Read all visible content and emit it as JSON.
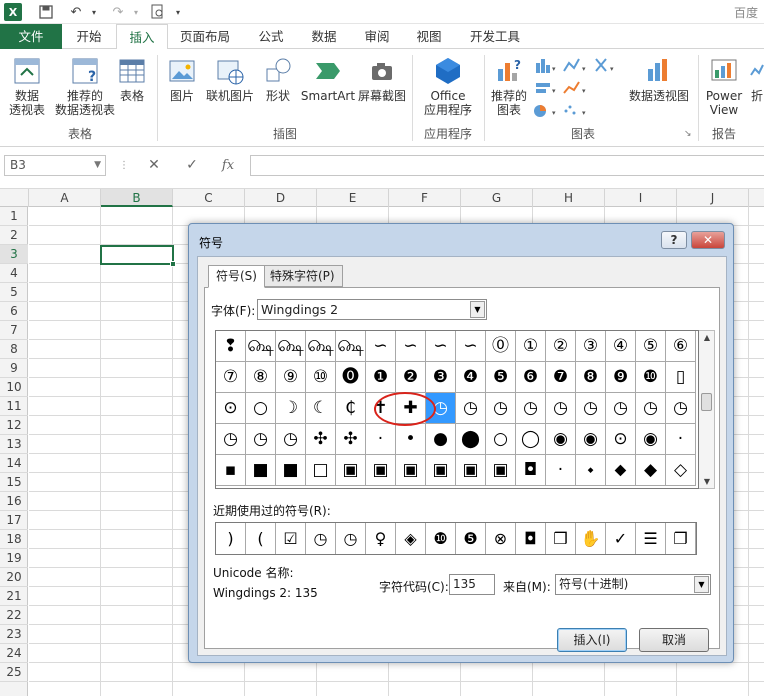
{
  "titlebar": {
    "right_text": "百度",
    "undo_icon": "undo-icon",
    "redo_icon": "redo-icon"
  },
  "ribbon": {
    "tabs": [
      "文件",
      "开始",
      "插入",
      "页面布局",
      "公式",
      "数据",
      "审阅",
      "视图",
      "开发工具"
    ],
    "active_tab": "插入",
    "buttons": [
      {
        "label": "数据\n透视表"
      },
      {
        "label": "推荐的\n数据透视表"
      },
      {
        "label": "表格"
      },
      {
        "label": "图片"
      },
      {
        "label": "联机图片"
      },
      {
        "label": "形状"
      },
      {
        "label": "SmartArt"
      },
      {
        "label": "屏幕截图"
      },
      {
        "label": "Office\n应用程序"
      },
      {
        "label": "推荐的\n图表"
      },
      {
        "label": "数据透视图"
      },
      {
        "label": "Power\nView"
      },
      {
        "label": "折"
      }
    ],
    "groups": [
      "表格",
      "插图",
      "应用程序",
      "图表",
      "报告"
    ]
  },
  "formula_bar": {
    "name_box": "B3",
    "cancel": "✕",
    "enter": "✓",
    "fx": "fx",
    "value": ""
  },
  "grid": {
    "columns": [
      "A",
      "B",
      "C",
      "D",
      "E",
      "F",
      "G",
      "H",
      "I",
      "J"
    ],
    "rows": [
      "1",
      "2",
      "3",
      "4",
      "5",
      "6",
      "7",
      "8",
      "9",
      "10",
      "11",
      "12",
      "13",
      "14",
      "15",
      "16",
      "17",
      "18",
      "19",
      "20",
      "21",
      "22",
      "23",
      "24",
      "25"
    ],
    "selected_cell": "B3"
  },
  "dialog": {
    "title": "符号",
    "help": "?",
    "close": "✕",
    "tab_symbols": "符号(S)",
    "tab_special": "特殊字符(P)",
    "font_label": "字体(F):",
    "font_value": "Wingdings 2",
    "symbols": [
      [
        "❢",
        "௸",
        "௸",
        "௸",
        "௸",
        "∽",
        "∽",
        "∽",
        "∽",
        "⓪",
        "①",
        "②",
        "③",
        "④",
        "⑤",
        "⑥"
      ],
      [
        "⑦",
        "⑧",
        "⑨",
        "⑩",
        "⓿",
        "❶",
        "❷",
        "❸",
        "❹",
        "❺",
        "❻",
        "❼",
        "❽",
        "❾",
        "❿",
        "▯"
      ],
      [
        "⊙",
        "○",
        "☽",
        "☾",
        "₵",
        "✝",
        "✚",
        "◷",
        "◷",
        "◷",
        "◷",
        "◷",
        "◷",
        "◷",
        "◷",
        "◷"
      ],
      [
        "◷",
        "◷",
        "◷",
        "✣",
        "✣",
        "·",
        "•",
        "●",
        "⬤",
        "○",
        "◯",
        "◉",
        "◉",
        "⊙",
        "◉",
        "·"
      ],
      [
        "▪",
        "■",
        "■",
        "□",
        "▣",
        "▣",
        "▣",
        "▣",
        "▣",
        "▣",
        "◘",
        "·",
        "⬩",
        "⬥",
        "◆",
        "◇"
      ]
    ],
    "selected_symbol": "◷",
    "recent_label": "近期使用过的符号(R):",
    "recent": [
      ")",
      "(",
      "☑",
      "◷",
      "◷",
      "♀",
      "◈",
      "❿",
      "❺",
      "⊗",
      "◘",
      "❒",
      "✋",
      "✓",
      "☰",
      "❐"
    ],
    "unicode_label": "Unicode 名称:",
    "unicode_value": "Wingdings 2: 135",
    "code_label": "字符代码(C):",
    "code_value": "135",
    "from_label": "来自(M):",
    "from_value": "符号(十进制)",
    "insert_button": "插入(I)",
    "cancel_button": "取消"
  }
}
